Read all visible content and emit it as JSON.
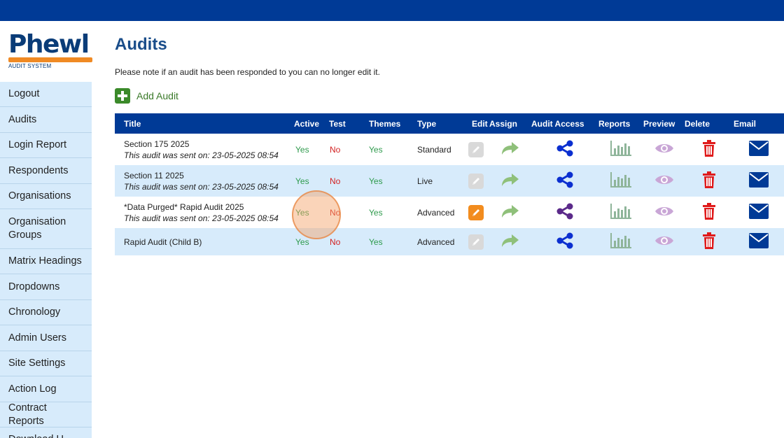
{
  "logo": {
    "word": "Phewl",
    "subtitle": "AUDIT SYSTEM"
  },
  "sidebar": {
    "items": [
      {
        "label": "Logout",
        "h": 36
      },
      {
        "label": "Audits",
        "h": 37
      },
      {
        "label": "Login Report",
        "h": 36
      },
      {
        "label": "Respondents",
        "h": 37
      },
      {
        "label": "Organisations",
        "h": 36
      },
      {
        "label": "Organisation Groups",
        "h": 57
      },
      {
        "label": "Matrix Headings",
        "h": 36
      },
      {
        "label": "Dropdowns",
        "h": 37
      },
      {
        "label": "Chronology",
        "h": 36
      },
      {
        "label": "Admin Users",
        "h": 37
      },
      {
        "label": "Site Settings",
        "h": 36
      },
      {
        "label": "Action Log",
        "h": 37
      },
      {
        "label": "Contract Reports",
        "h": 36
      },
      {
        "label": "Download U...",
        "h": 36
      }
    ]
  },
  "page": {
    "title": "Audits",
    "note": "Please note if an audit has been responded to you can no longer edit it.",
    "add_label": "Add Audit"
  },
  "table": {
    "headers": {
      "title": "Title",
      "active": "Active",
      "test": "Test",
      "themes": "Themes",
      "type": "Type",
      "edit": "Edit",
      "assign": "Assign",
      "access": "Audit Access",
      "reports": "Reports",
      "preview": "Preview",
      "delete": "Delete",
      "email": "Email"
    },
    "rows": [
      {
        "title": "Section 175 2025",
        "sent": "This audit was sent on: 23-05-2025 08:54",
        "active": "Yes",
        "test": "No",
        "themes": "Yes",
        "type": "Standard",
        "editable": false
      },
      {
        "title": "Section 11 2025",
        "sent": "This audit was sent on: 23-05-2025 08:54",
        "active": "Yes",
        "test": "No",
        "themes": "Yes",
        "type": "Live",
        "editable": false
      },
      {
        "title": "*Data Purged* Rapid Audit 2025",
        "sent": "This audit was sent on: 23-05-2025 08:54",
        "active": "Yes",
        "test": "No",
        "themes": "Yes",
        "type": "Advanced",
        "editable": true
      },
      {
        "title": "Rapid Audit (Child B)",
        "sent": "",
        "active": "Yes",
        "test": "No",
        "themes": "Yes",
        "type": "Advanced",
        "editable": false
      }
    ]
  },
  "icons": {
    "edit": "pencil-icon",
    "assign": "forward-arrow-icon",
    "access": "share-icon",
    "reports": "bar-chart-icon",
    "preview": "eye-icon",
    "delete": "trash-icon",
    "email": "envelope-icon"
  },
  "colors": {
    "topbar": "#003a96",
    "sidebar": "#d7ebfb",
    "title": "#1a4d8a",
    "yes": "#2e9a4c",
    "no": "#d32222",
    "edit_active": "#f28c1e",
    "edit_inactive": "#d9d9d9",
    "assign": "#8fc07a",
    "share": "#0b2fd0",
    "share_visited": "#5b2a8a",
    "reports": "#8fb59a",
    "preview": "#c9a6d6",
    "delete": "#e01b1b",
    "email": "#003a96"
  }
}
